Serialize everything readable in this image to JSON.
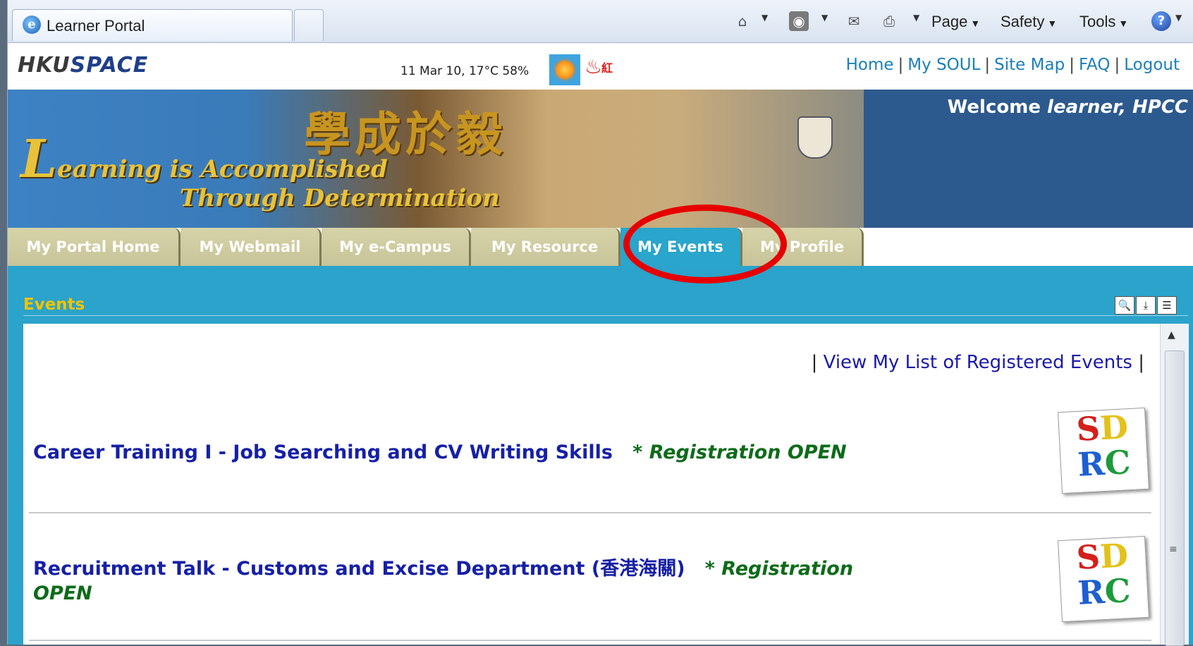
{
  "browser": {
    "tab_title": "Learner Portal",
    "menus": [
      "Page",
      "Safety",
      "Tools"
    ]
  },
  "header": {
    "logo_part1": "HKU",
    "logo_part2": "SPACE",
    "weather": "11 Mar 10, 17°C 58%",
    "fire_label": "紅",
    "links": [
      "Home",
      "My SOUL",
      "Site Map",
      "FAQ",
      "Logout"
    ]
  },
  "banner": {
    "chinese": "學成於毅",
    "line1": "earning is Accomplished",
    "line1_initial": "L",
    "line2": "Through Determination",
    "welcome_prefix": "Welcome ",
    "welcome_name": "learner, HPCC"
  },
  "nav": {
    "tabs": [
      "My Portal Home",
      "My Webmail",
      "My e-Campus",
      "My Resource",
      "My Events",
      "My Profile"
    ],
    "active": "My Events"
  },
  "content": {
    "section_title": "Events",
    "registered_link": "View My List of Registered Events",
    "events": [
      {
        "title": "Career Training I - Job Searching and CV Writing Skills",
        "status": "* Registration OPEN"
      },
      {
        "title": "Recruitment Talk - Customs and Excise Department (香港海關)",
        "status": "* Registration",
        "status2": "OPEN"
      }
    ],
    "sdrc_letters": [
      "S",
      "D",
      "R",
      "C"
    ]
  }
}
